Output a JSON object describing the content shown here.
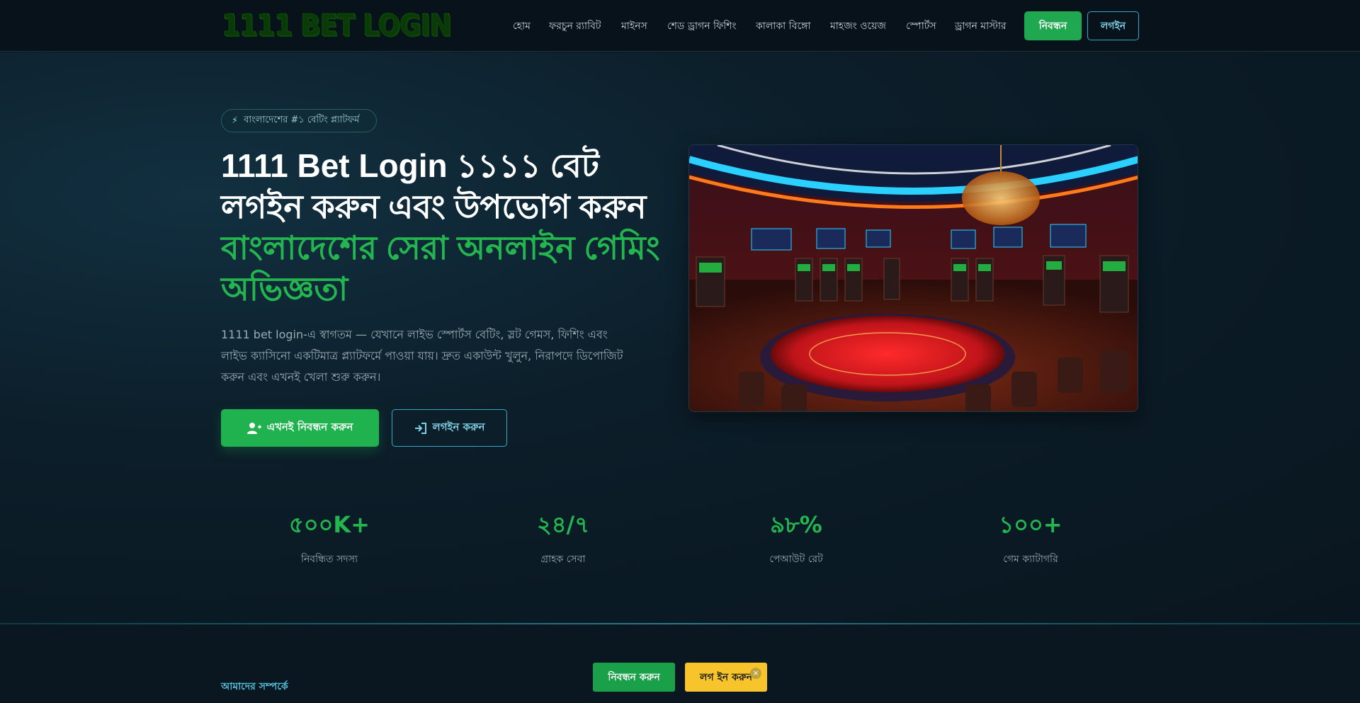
{
  "header": {
    "logo": "1111 BET LOGIN",
    "nav": [
      "হোম",
      "ফরচুন র‍্যাবিট",
      "মাইনস",
      "শেড ড্রাগন ফিশিং",
      "কালাকা বিঙ্গো",
      "মাহজং ওয়েজ",
      "স্পোর্টস",
      "ড্রাগন মাস্টার"
    ],
    "register_label": "নিবন্ধন",
    "login_label": "লগইন"
  },
  "hero": {
    "badge_icon": "bolt-icon",
    "badge": "বাংলাদেশের #১ বেটিং প্ল্যাটফর্ম",
    "title_line1": "1111 Bet Login ১১১১ বেট",
    "title_line2": "লগইন করুন এবং উপভোগ করুন",
    "title_green1": "বাংলাদেশের সেরা অনলাইন গেমিং",
    "title_green2": "অভিজ্ঞতা",
    "description": "1111 bet login-এ স্বাগতম — যেখানে লাইভ স্পোর্টস বেটিং, স্লট গেমস, ফিশিং এবং লাইভ ক্যাসিনো একটিমাত্র প্ল্যাটফর্মে পাওয়া যায়। দ্রুত একাউন্ট খুলুন, নিরাপদে ডিপোজিট করুন এবং এখনই খেলা শুরু করুন।",
    "cta_primary": "এখনই নিবন্ধন করুন",
    "cta_secondary": "লগইন করুন"
  },
  "stats": [
    {
      "value": "৫০০K+",
      "label": "নিবন্ধিত সদস্য"
    },
    {
      "value": "২৪/৭",
      "label": "গ্রাহক সেবা"
    },
    {
      "value": "৯৮%",
      "label": "পেআউট রেট"
    },
    {
      "value": "১০০+",
      "label": "গেম ক্যাটাগরি"
    }
  ],
  "about": {
    "heading": "আমাদের সম্পর্কে"
  },
  "floating": {
    "register": "নিবন্ধন করুন",
    "login": "লগ ইন করুন",
    "close": "×"
  },
  "colors": {
    "accent_green": "#1fb24f",
    "accent_cyan": "#33aac4",
    "floating_yellow": "#f7c52b"
  }
}
